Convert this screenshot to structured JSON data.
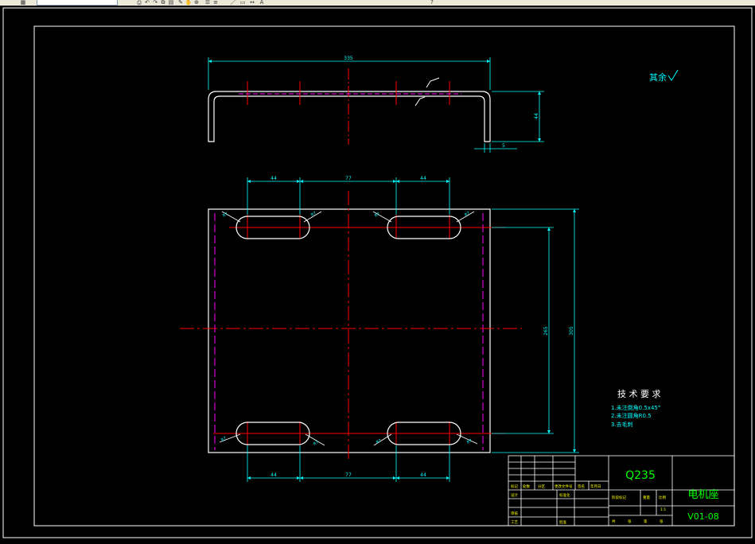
{
  "toolbar": {
    "icons": [
      "table-icon",
      "print-icon",
      "undo-icon",
      "redo-icon",
      "copy-icon",
      "paste-icon",
      "match-icon",
      "pan-icon",
      "zoom-icon",
      "properties-icon",
      "layer-icon",
      "line-icon",
      "rectangle-icon",
      "dimension-icon",
      "text-icon",
      "help-icon"
    ]
  },
  "drawing": {
    "top_view": {
      "width_dim": "335",
      "height_dim": "44",
      "thickness_dim": "5"
    },
    "plan_view": {
      "top_dims": [
        "44",
        "77",
        "44"
      ],
      "bottom_dims": [
        "44",
        "77",
        "44"
      ],
      "inner_height_dim": "265",
      "outer_height_dim": "305",
      "slot_radius_labels": [
        "R7",
        "R7",
        "R7",
        "R7",
        "R7",
        "R7",
        "R7",
        "R7"
      ]
    },
    "surface_note": "其余",
    "tech_requirements": {
      "title": "技 术 要 求",
      "items": [
        "1.未注倒角0.5x45°",
        "2.未注圆角R0.5",
        "3.去毛刺"
      ]
    },
    "title_block": {
      "material": "Q235",
      "part_name": "电机座",
      "drawing_number": "V01-08",
      "row_labels": [
        "标记",
        "处数",
        "分区",
        "更改文件号",
        "签名",
        "年月日"
      ],
      "labels2": [
        "设计",
        "标准化",
        "阶段标记",
        "重量",
        "比例"
      ],
      "labels3": [
        "审核",
        "工艺",
        "批准"
      ],
      "scale": "1:1",
      "sheet": [
        "共",
        "张",
        "第",
        "张"
      ]
    }
  },
  "colors": {
    "background": "#000000",
    "geometry": "#ffffff",
    "dimension": "#00ffff",
    "centerline": "#ff0000",
    "hidden": "#ff00ff",
    "title_text": "#00ff00",
    "frame": "#ffffff"
  }
}
